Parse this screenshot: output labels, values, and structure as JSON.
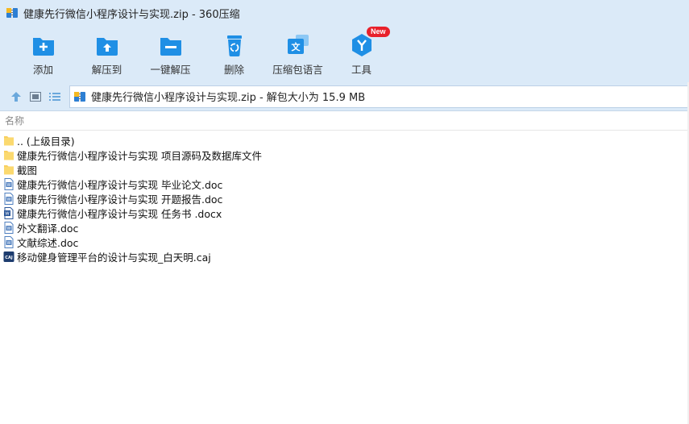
{
  "window": {
    "title": "健康先行微信小程序设计与实现.zip - 360压缩"
  },
  "toolbar": {
    "items": [
      {
        "label": "添加",
        "icon": "add-icon"
      },
      {
        "label": "解压到",
        "icon": "extract-to-icon"
      },
      {
        "label": "一键解压",
        "icon": "one-click-extract-icon"
      },
      {
        "label": "删除",
        "icon": "delete-icon"
      },
      {
        "label": "压缩包语言",
        "icon": "language-icon"
      },
      {
        "label": "工具",
        "icon": "tools-icon",
        "badge": "New"
      }
    ],
    "accent": "#1f8fe5"
  },
  "path": {
    "text": "健康先行微信小程序设计与实现.zip - 解包大小为 15.9 MB"
  },
  "list": {
    "header_name": "名称",
    "items": [
      {
        "name": ".. (上级目录)",
        "type": "folder"
      },
      {
        "name": "健康先行微信小程序设计与实现 项目源码及数据库文件",
        "type": "folder"
      },
      {
        "name": "截图",
        "type": "folder"
      },
      {
        "name": "健康先行微信小程序设计与实现 毕业论文.doc",
        "type": "doc"
      },
      {
        "name": "健康先行微信小程序设计与实现 开题报告.doc",
        "type": "doc"
      },
      {
        "name": "健康先行微信小程序设计与实现 任务书 .docx",
        "type": "docx"
      },
      {
        "name": "外文翻译.doc",
        "type": "doc"
      },
      {
        "name": "文献综述.doc",
        "type": "doc"
      },
      {
        "name": "移动健身管理平台的设计与实现_白天明.caj",
        "type": "caj"
      }
    ]
  }
}
